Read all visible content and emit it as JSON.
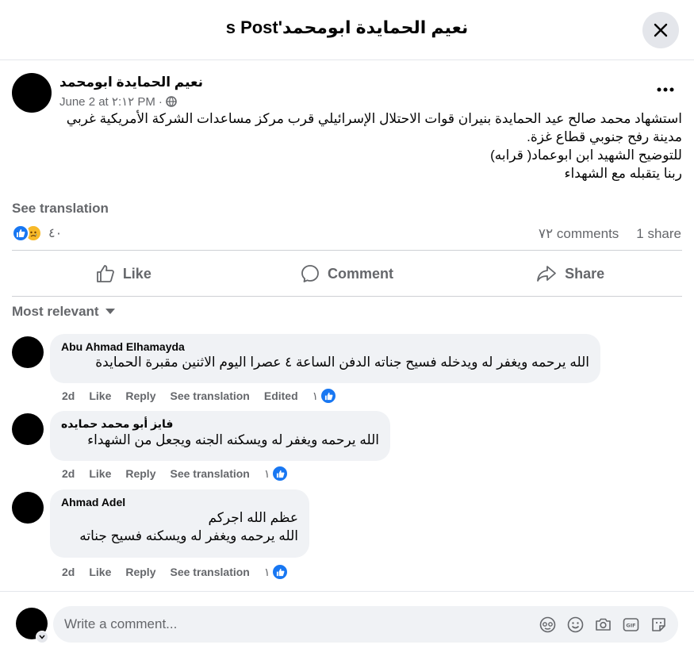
{
  "header": {
    "title": "نعيم الحمايدة ابومحمد's Post"
  },
  "post": {
    "author": "نعيم الحمايدة ابومحمد",
    "date": "June 2 at ٢:١٢ PM",
    "separator": "·",
    "lines": [
      "استشهاد محمد صالح عيد الحمايدة  بنيران قوات الاحتلال الإسرائيلي قرب مركز مساعدات الشركة الأمريكية غربي",
      "مدينة رفح جنوبي قطاع غزة.",
      "للتوضيح الشهيد ابن ابوعماد(  قرابه)",
      "ربنا يتقبله مع الشهداء"
    ],
    "see_translation": "See translation",
    "reaction_count": "٤٠",
    "comments_count": "٧٢ comments",
    "shares_count": "1 share"
  },
  "actions": {
    "like": "Like",
    "comment": "Comment",
    "share": "Share"
  },
  "sort_label": "Most relevant",
  "comments": [
    {
      "name": "Abu Ahmad Elhamayda",
      "lines": [
        "الله يرحمه ويغفر له ويدخله فسيح جناته الدفن الساعة ٤ عصرا اليوم الاثنين مقبرة الحمايدة"
      ],
      "time": "2d",
      "like": "Like",
      "reply": "Reply",
      "see_translation": "See translation",
      "edited": "Edited",
      "reactions": "١"
    },
    {
      "name": "فايز أبو محمد حمايده",
      "lines": [
        "الله يرحمه ويغفر له ويسكنه الجنه ويجعل من الشهداء"
      ],
      "time": "2d",
      "like": "Like",
      "reply": "Reply",
      "see_translation": "See translation",
      "reactions": "١"
    },
    {
      "name": "Ahmad Adel",
      "lines": [
        "عظم الله اجركم",
        "الله يرحمه ويغفر له ويسكنه فسيح جناته"
      ],
      "time": "2d",
      "like": "Like",
      "reply": "Reply",
      "see_translation": "See translation",
      "reactions": "١"
    }
  ],
  "composer": {
    "placeholder": "Write a comment..."
  },
  "colors": {
    "like_blue": "#1877f2",
    "secondary_text": "#65676b",
    "bubble_bg": "#f0f2f5"
  },
  "icons": [
    "close-icon",
    "more-icon",
    "globe-icon",
    "like-icon",
    "comment-icon",
    "share-icon",
    "caret-down-icon",
    "avatar-sticker-icon",
    "emoji-icon",
    "camera-icon",
    "gif-icon",
    "sticker-icon"
  ]
}
